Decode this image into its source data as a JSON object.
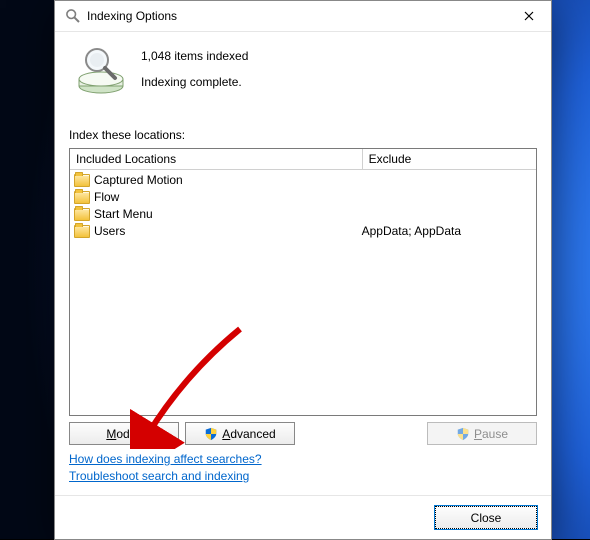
{
  "window": {
    "title": "Indexing Options"
  },
  "status": {
    "count_line": "1,048 items indexed",
    "state_line": "Indexing complete."
  },
  "locations_label": "Index these locations:",
  "columns": {
    "included": "Included Locations",
    "exclude": "Exclude"
  },
  "locations": [
    {
      "name": "Captured Motion",
      "exclude": ""
    },
    {
      "name": "Flow",
      "exclude": ""
    },
    {
      "name": "Start Menu",
      "exclude": ""
    },
    {
      "name": "Users",
      "exclude": "AppData; AppData"
    }
  ],
  "buttons": {
    "modify": "Modify",
    "advanced": "Advanced",
    "pause": "Pause",
    "close": "Close"
  },
  "links": {
    "how": "How does indexing affect searches?",
    "troubleshoot": "Troubleshoot search and indexing"
  }
}
